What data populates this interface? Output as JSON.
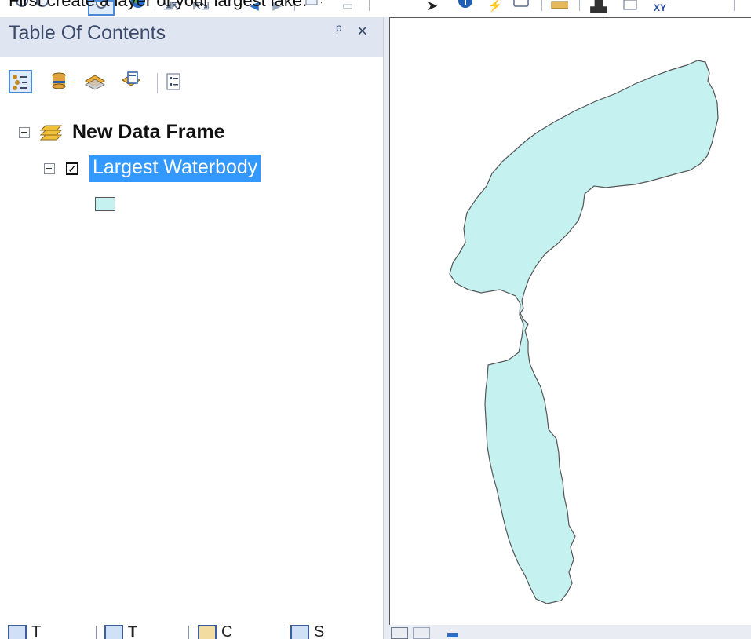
{
  "caption": "First create a layer of your largest lake.",
  "toolbar": {
    "icons": [
      "zoom-in-icon",
      "zoom-out-icon",
      "pan-icon",
      "full-extent-icon",
      "fixed-zoom-in-icon",
      "fixed-zoom-out-icon",
      "back-extent-icon",
      "forward-extent-icon",
      "select-features-icon",
      "clear-selection-icon",
      "select-elements-icon",
      "identify-icon",
      "hyperlink-icon",
      "html-popup-icon",
      "measure-icon",
      "find-icon",
      "find-route-icon",
      "go-to-xy-icon"
    ],
    "xy_label": "XY"
  },
  "toc": {
    "title": "Table Of Contents",
    "pin_glyph": "ᴪ",
    "close_glyph": "×",
    "tools": [
      "list-by-drawing-order-icon",
      "list-by-source-icon",
      "list-by-visibility-icon",
      "list-by-selection-icon",
      "options-icon"
    ],
    "data_frame": "New Data Frame",
    "layer": {
      "name": "Largest Waterbody",
      "checked": true,
      "check_glyph": "✓",
      "fill_color": "#c5f1f1"
    }
  },
  "bottom_tabs": [
    {
      "label": "T",
      "icon": "table-tab-icon"
    },
    {
      "label": "T",
      "icon": "toc-tab-icon"
    },
    {
      "label": "C",
      "icon": "catalog-tab-icon"
    },
    {
      "label": "S",
      "icon": "search-tab-icon"
    }
  ],
  "map": {
    "lake_fill": "#c5f1f1",
    "lake_outline": "#555555"
  }
}
